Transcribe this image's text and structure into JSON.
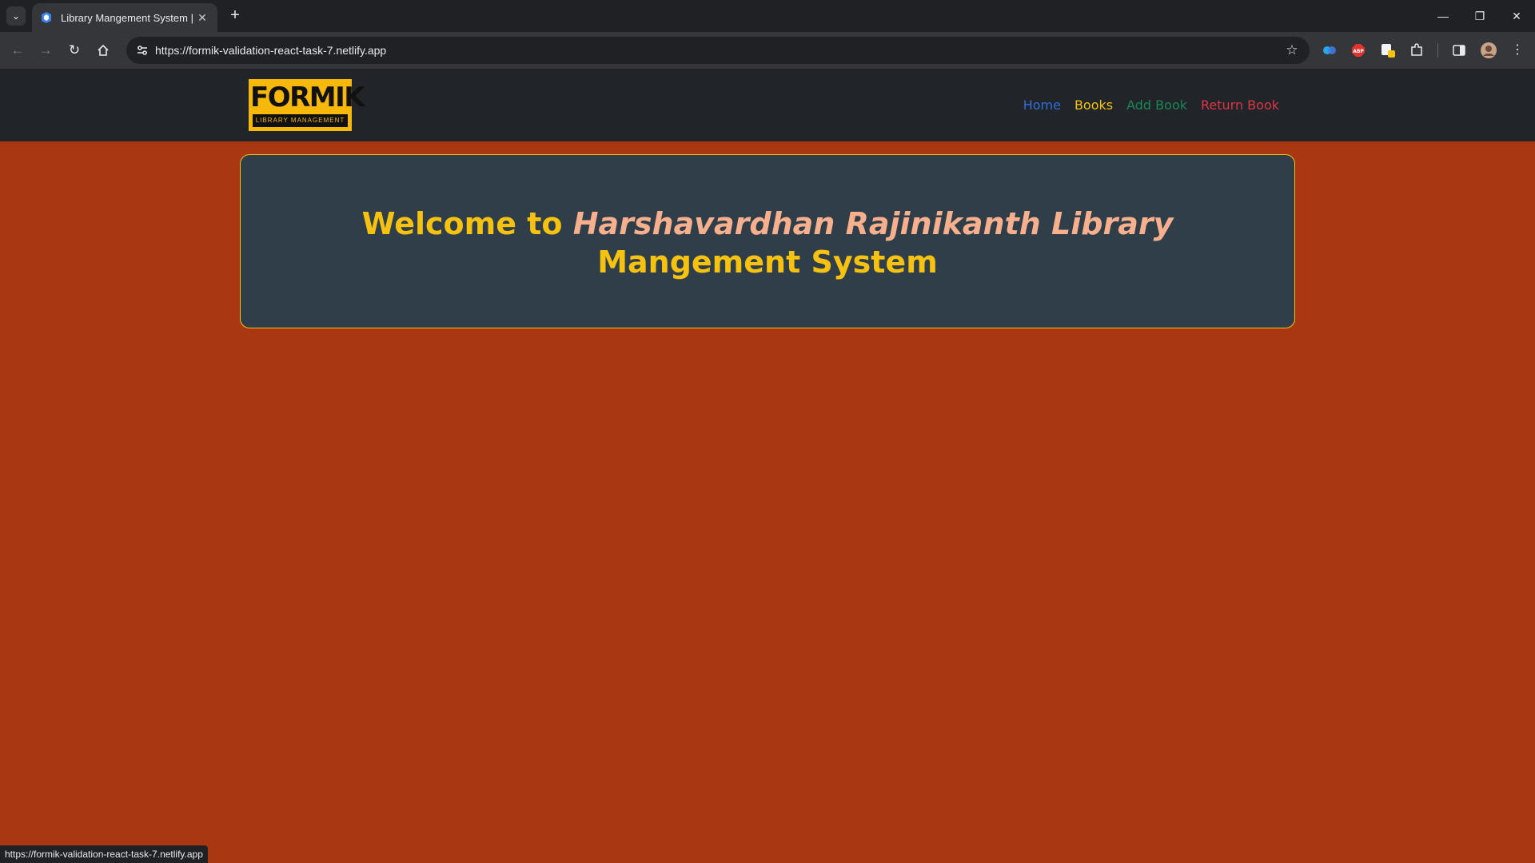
{
  "browser": {
    "tab_title": "Library Mangement System | Sw",
    "new_tab_label": "+",
    "url": "https://formik-validation-react-task-7.netlify.app",
    "status_url": "https://formik-validation-react-task-7.netlify.app",
    "window_controls": {
      "minimize_icon": "minimize-icon",
      "restore_icon": "restore-icon",
      "close_icon": "close-icon"
    },
    "extensions": [
      "copilot-icon",
      "adblock-icon",
      "extension-badge-icon",
      "puzzle-icon"
    ]
  },
  "logo": {
    "word": "FORMIK",
    "subtitle": "LIBRARY MANAGEMENT",
    "color": "#f6b80b"
  },
  "nav": {
    "items": [
      {
        "label": "Home",
        "color": "#2f6fdb"
      },
      {
        "label": "Books",
        "color": "#f5c211"
      },
      {
        "label": "Add Book",
        "color": "#198754"
      },
      {
        "label": "Return Book",
        "color": "#dc3545"
      }
    ]
  },
  "welcome": {
    "prefix": "Welcome to",
    "highlight": "Harshavardhan Rajinikanth Library",
    "suffix": "Mangement System"
  },
  "colors": {
    "page_background": "#a93812",
    "navbar_background": "#212529",
    "card_background": "#2f3e48",
    "card_border": "#f5c211"
  }
}
